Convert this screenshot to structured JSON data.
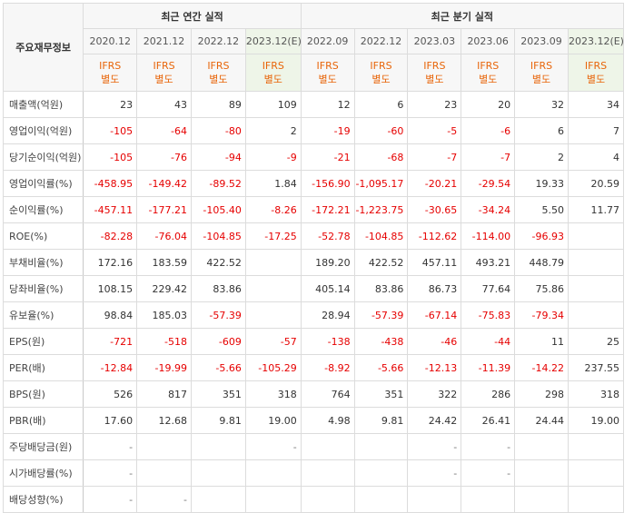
{
  "header": {
    "corner_label": "주요재무정보",
    "annual_group": "최근 연간 실적",
    "quarter_group": "최근 분기 실적",
    "columns": [
      "2020.12",
      "2021.12",
      "2022.12",
      "2023.12(E)",
      "2022.09",
      "2022.12",
      "2023.03",
      "2023.06",
      "2023.09",
      "2023.12(E)"
    ],
    "basis_line1": "IFRS",
    "basis_line2": "별도"
  },
  "rows": [
    {
      "label": "매출액(억원)",
      "values": [
        "23",
        "43",
        "89",
        "109",
        "12",
        "6",
        "23",
        "20",
        "32",
        "34"
      ]
    },
    {
      "label": "영업이익(억원)",
      "values": [
        "-105",
        "-64",
        "-80",
        "2",
        "-19",
        "-60",
        "-5",
        "-6",
        "6",
        "7"
      ]
    },
    {
      "label": "당기순이익(억원)",
      "values": [
        "-105",
        "-76",
        "-94",
        "-9",
        "-21",
        "-68",
        "-7",
        "-7",
        "2",
        "4"
      ]
    },
    {
      "label": "영업이익률(%)",
      "values": [
        "-458.95",
        "-149.42",
        "-89.52",
        "1.84",
        "-156.90",
        "-1,095.17",
        "-20.21",
        "-29.54",
        "19.33",
        "20.59"
      ]
    },
    {
      "label": "순이익률(%)",
      "values": [
        "-457.11",
        "-177.21",
        "-105.40",
        "-8.26",
        "-172.21",
        "-1,223.75",
        "-30.65",
        "-34.24",
        "5.50",
        "11.77"
      ]
    },
    {
      "label": "ROE(%)",
      "values": [
        "-82.28",
        "-76.04",
        "-104.85",
        "-17.25",
        "-52.78",
        "-104.85",
        "-112.62",
        "-114.00",
        "-96.93",
        ""
      ]
    },
    {
      "label": "부채비율(%)",
      "values": [
        "172.16",
        "183.59",
        "422.52",
        "",
        "189.20",
        "422.52",
        "457.11",
        "493.21",
        "448.79",
        ""
      ]
    },
    {
      "label": "당좌비율(%)",
      "values": [
        "108.15",
        "229.42",
        "83.86",
        "",
        "405.14",
        "83.86",
        "86.73",
        "77.64",
        "75.86",
        ""
      ]
    },
    {
      "label": "유보율(%)",
      "values": [
        "98.84",
        "185.03",
        "-57.39",
        "",
        "28.94",
        "-57.39",
        "-67.14",
        "-75.83",
        "-79.34",
        ""
      ]
    },
    {
      "label": "EPS(원)",
      "values": [
        "-721",
        "-518",
        "-609",
        "-57",
        "-138",
        "-438",
        "-46",
        "-44",
        "11",
        "25"
      ]
    },
    {
      "label": "PER(배)",
      "values": [
        "-12.84",
        "-19.99",
        "-5.66",
        "-105.29",
        "-8.92",
        "-5.66",
        "-12.13",
        "-11.39",
        "-14.22",
        "237.55"
      ]
    },
    {
      "label": "BPS(원)",
      "values": [
        "526",
        "817",
        "351",
        "318",
        "764",
        "351",
        "322",
        "286",
        "298",
        "318"
      ]
    },
    {
      "label": "PBR(배)",
      "values": [
        "17.60",
        "12.68",
        "9.81",
        "19.00",
        "4.98",
        "9.81",
        "24.42",
        "26.41",
        "24.44",
        "19.00"
      ]
    },
    {
      "label": "주당배당금(원)",
      "values": [
        "-",
        "",
        "",
        "-",
        "",
        "",
        "-",
        "-",
        "",
        ""
      ]
    },
    {
      "label": "시가배당률(%)",
      "values": [
        "-",
        "",
        "",
        "",
        "",
        "",
        "-",
        "-",
        "",
        ""
      ]
    },
    {
      "label": "배당성향(%)",
      "values": [
        "-",
        "-",
        "",
        "",
        "",
        "",
        "",
        "",
        "",
        ""
      ]
    }
  ],
  "colors": {
    "negative": "#e60000",
    "basis": "#e8650a",
    "estimate_bg": "#eef5e8"
  }
}
